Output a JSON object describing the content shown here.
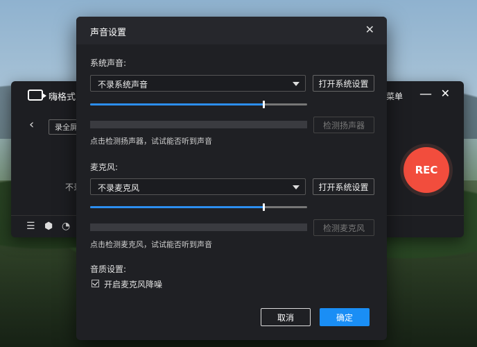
{
  "app": {
    "title": "嗨格式录",
    "menu_label": "菜单",
    "mode_label": "录全屏",
    "hint": "不录",
    "rec_label": "REC",
    "minimize_glyph": "—",
    "close_glyph": "✕",
    "back_glyph": "‹"
  },
  "dialog": {
    "title": "声音设置",
    "close_glyph": "✕",
    "system": {
      "section_label": "系统声音:",
      "select_value": "不录系统声音",
      "open_settings": "打开系统设置",
      "volume_percent": 80,
      "detect_button": "检测扬声器",
      "hint": "点击检测扬声器，试试能否听到声音"
    },
    "mic": {
      "section_label": "麦克风:",
      "select_value": "不录麦克风",
      "open_settings": "打开系统设置",
      "volume_percent": 80,
      "detect_button": "检测麦克风",
      "hint": "点击检测麦克风，试试能否听到声音"
    },
    "quality": {
      "section_label": "音质设置:",
      "noise_reduction_label": "开启麦克风降噪",
      "noise_reduction_checked": true
    },
    "cancel_label": "取消",
    "confirm_label": "确定"
  },
  "colors": {
    "accent": "#2c8ef0",
    "confirm": "#1a8ef5",
    "rec": "#f24d3d",
    "dialog_bg": "#1f2024"
  }
}
